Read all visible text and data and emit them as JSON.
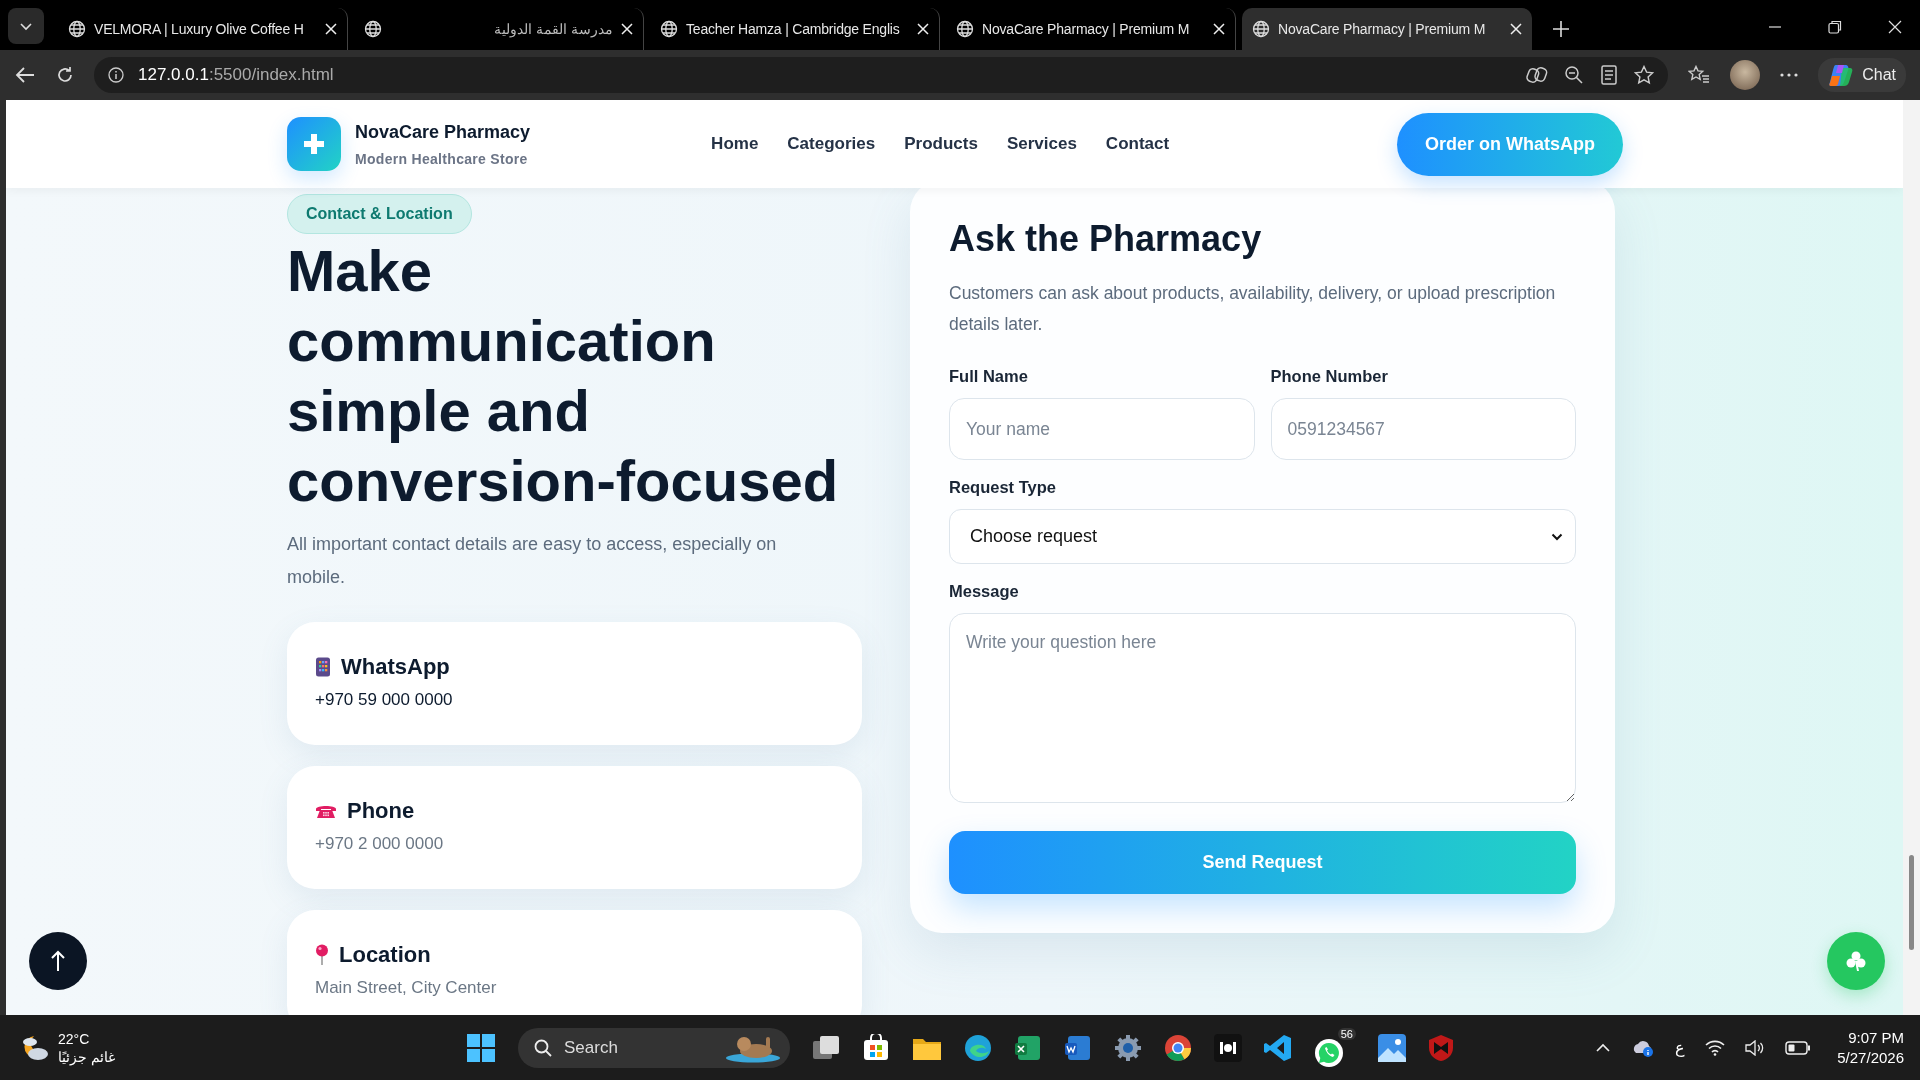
{
  "browser": {
    "tabs": [
      {
        "title": "VELMORA | Luxury Olive Coffee H",
        "rtl": false,
        "selected": false
      },
      {
        "title": "مدرسة القمة الدولية",
        "rtl": true,
        "selected": false
      },
      {
        "title": "Teacher Hamza | Cambridge Englis",
        "rtl": false,
        "selected": false
      },
      {
        "title": "NovaCare Pharmacy | Premium M",
        "rtl": false,
        "selected": false
      },
      {
        "title": "NovaCare Pharmacy | Premium M",
        "rtl": false,
        "selected": true
      }
    ],
    "address": {
      "host": "127.0.0.1",
      "rest": ":5500/index.html"
    },
    "chat": "Chat"
  },
  "page": {
    "brand": {
      "name": "NovaCare Pharmacy",
      "tagline": "Modern Healthcare Store"
    },
    "nav": [
      "Home",
      "Categories",
      "Products",
      "Services",
      "Contact"
    ],
    "cta": "Order on WhatsApp",
    "badge": "Contact & Location",
    "heading": "Make communication simple and conversion-focused",
    "intro": "All important contact details are easy to access, especially on mobile.",
    "contacts": [
      {
        "kind": "mobile",
        "title": "WhatsApp",
        "value": "+970 59 000 0000",
        "emphasized": true
      },
      {
        "kind": "phone",
        "title": "Phone",
        "value": "+970 2 000 0000",
        "emphasized": false
      },
      {
        "kind": "pin",
        "title": "Location",
        "value": "Main Street, City Center",
        "emphasized": false
      }
    ],
    "form": {
      "title": "Ask the Pharmacy",
      "description": "Customers can ask about products, availability, delivery, or upload prescription details later.",
      "name": {
        "label": "Full Name",
        "placeholder": "Your name"
      },
      "phone": {
        "label": "Phone Number",
        "placeholder": "0591234567"
      },
      "request": {
        "label": "Request Type",
        "value": "Choose request"
      },
      "message": {
        "label": "Message",
        "placeholder": "Write your question here"
      },
      "submit": "Send Request"
    }
  },
  "taskbar": {
    "temperature": "22°C",
    "weather": "غائم جزئيًا",
    "search": "Search",
    "whatsapp_badge": "56",
    "language": "ع",
    "time": "9:07 PM",
    "date": "5/27/2026"
  }
}
